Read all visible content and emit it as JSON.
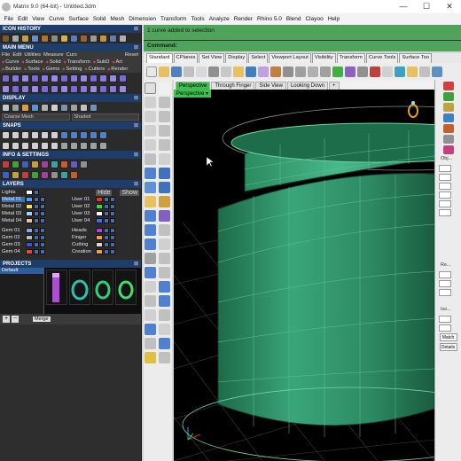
{
  "window": {
    "title": "Matrix 9.0 (64-bit) - Untitled.3dm",
    "minimize": "—",
    "maximize": "☐",
    "close": "✕"
  },
  "menubar": [
    "File",
    "Edit",
    "View",
    "Curve",
    "Surface",
    "Solid",
    "Mesh",
    "Dimension",
    "Transform",
    "Tools",
    "Analyze",
    "Render",
    "Rhino 5.0",
    "Blend",
    "Clayoo",
    "Help"
  ],
  "left": {
    "icon_history": "ICON HISTORY",
    "main_menu": "MAIN MENU",
    "reset": "Reset",
    "main_menu_items": [
      "File",
      "Edit",
      "Utilities",
      "Measure",
      "Curs"
    ],
    "mm_row2": [
      "Curve",
      "Surface",
      "Solid",
      "Transform",
      "SubD",
      "Art"
    ],
    "mm_row3": [
      "Builder",
      "Tools",
      "Gems",
      "Setting",
      "Cutters",
      "Render"
    ],
    "display": "DISPLAY",
    "display_mode1": "Coarse Mesh",
    "display_mode2": "Shaded",
    "snaps": "SNAPS",
    "info_settings": "INFO & SETTINGS",
    "layers": "LAYERS",
    "lights": "Lights",
    "hide": "Hide",
    "show": "Show",
    "layers_left": [
      {
        "name": "Metal 01",
        "color": "#4fa3ff",
        "selected": true
      },
      {
        "name": "Metal 02",
        "color": "#ffe23d"
      },
      {
        "name": "Metal 03",
        "color": "#9bd6ff"
      },
      {
        "name": "Metal 04",
        "color": "#f2c08a"
      },
      {
        "name": "Gem 01",
        "color": "#6fb2e6"
      },
      {
        "name": "Gem 02",
        "color": "#bdbdbd"
      },
      {
        "name": "Gem 03",
        "color": "#3a57c8"
      },
      {
        "name": "Gem 04",
        "color": "#e04848"
      }
    ],
    "layers_right": [
      {
        "name": "User 01",
        "color": "#f03030"
      },
      {
        "name": "User 02",
        "color": "#2ee02e"
      },
      {
        "name": "User 03",
        "color": "#ffffff"
      },
      {
        "name": "User 04",
        "color": "#3e6ef0"
      },
      {
        "name": "Heads",
        "color": "#b040e0"
      },
      {
        "name": "Finger",
        "color": "#ff9a2e"
      },
      {
        "name": "Cutting",
        "color": "#d8d8d8"
      },
      {
        "name": "Creation",
        "color": "#f0a02a"
      }
    ],
    "projects": "PROJECTS",
    "project_item": "Default",
    "merge": "Merge"
  },
  "command": {
    "history": "1 curve added to selection",
    "prompt": "Command:"
  },
  "toolbar_tabs": [
    "Standard",
    "CPlanes",
    "Set View",
    "Display",
    "Select",
    "Viewport Layout",
    "Visibility",
    "Transform",
    "Curve Tools",
    "Surface Too"
  ],
  "viewport": {
    "tabs": [
      "Perspective",
      "Through Finger",
      "Side View",
      "Looking Down"
    ],
    "add_tab": "+",
    "label": "Perspective"
  },
  "right": {
    "labels": [
      "Obj...",
      "Re...",
      "Iso...",
      "Re..."
    ],
    "match": "Match",
    "details": "Details"
  },
  "colors": {
    "accent_green": "#3fbf4f",
    "command_green": "#4fa35a",
    "panel_dark": "#2e2e2e",
    "section_blue": "#1e3d6b",
    "model_green": "#2f8a62"
  }
}
